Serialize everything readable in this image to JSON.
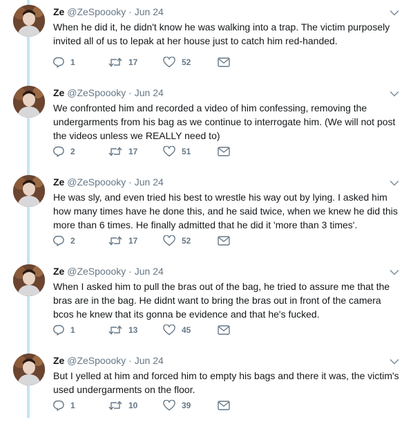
{
  "tweets": [
    {
      "name": "Ze",
      "handle": "@ZeSpoooky",
      "separator": "·",
      "date": "Jun 24",
      "text": "When he did it, he didn't know he was walking into a trap. The victim purposely invited all of us to lepak at her house just to catch him red-handed.",
      "replies": "1",
      "retweets": "17",
      "likes": "52"
    },
    {
      "name": "Ze",
      "handle": "@ZeSpoooky",
      "separator": "·",
      "date": "Jun 24",
      "text": "We confronted him and recorded a video of him confessing, removing the undergarments from his bag as we continue to interrogate him. (We will not post the videos unless we REALLY need to)",
      "replies": "2",
      "retweets": "17",
      "likes": "51"
    },
    {
      "name": "Ze",
      "handle": "@ZeSpoooky",
      "separator": "·",
      "date": "Jun 24",
      "text": "He was sly, and even tried his best to wrestle his way out by lying. I asked him how many times have he done this, and he said twice, when we knew he did this more than 6 times. He finally admitted that he did it 'more than 3 times'.",
      "replies": "2",
      "retweets": "17",
      "likes": "52"
    },
    {
      "name": "Ze",
      "handle": "@ZeSpoooky",
      "separator": "·",
      "date": "Jun 24",
      "text": "When I asked him to pull the bras out of the bag, he tried to assure me that the bras are in the bag. He didnt want to bring the bras out in front of the camera bcos he knew that its gonna be evidence and that he's fucked.",
      "replies": "1",
      "retweets": "13",
      "likes": "45"
    },
    {
      "name": "Ze",
      "handle": "@ZeSpoooky",
      "separator": "·",
      "date": "Jun 24",
      "text": "But I yelled at him and forced him to empty his bags and there it was, the victim's used undergarments on the floor.",
      "replies": "1",
      "retweets": "10",
      "likes": "39"
    }
  ],
  "icons": {
    "reply": "reply-icon",
    "retweet": "retweet-icon",
    "like": "heart-icon",
    "dm": "envelope-icon",
    "caret": "chevron-down-icon"
  },
  "colors": {
    "thread_line": "#c4e4f7",
    "secondary_text": "#657786",
    "primary_text": "#14171a"
  }
}
